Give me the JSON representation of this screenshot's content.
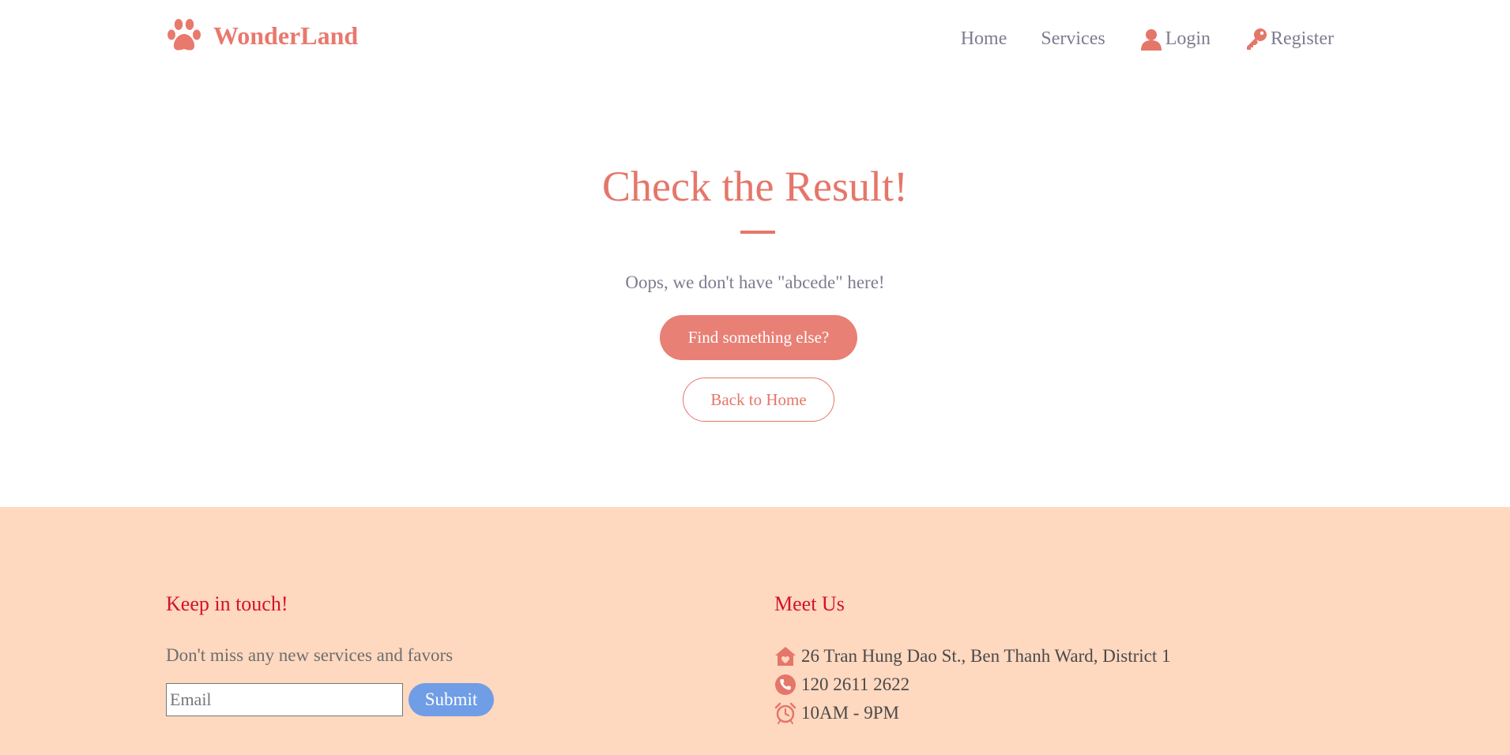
{
  "brand": {
    "name": "WonderLand",
    "icon": "paw-icon",
    "color": "#e9786d"
  },
  "nav": {
    "home": "Home",
    "services": "Services",
    "login": "Login",
    "login_icon": "user-icon",
    "register": "Register",
    "register_icon": "key-icon"
  },
  "main": {
    "title": "Check the Result!",
    "message": "Oops, we don't have \"abcede\" here!",
    "find_button": "Find something else?",
    "home_button": "Back to Home"
  },
  "footer": {
    "keep_title": "Keep in touch!",
    "subscribe_text": "Don't miss any new services and favors",
    "email_placeholder": "Email",
    "submit_label": "Submit",
    "meet_title": "Meet Us",
    "address": "26 Tran Hung Dao St., Ben Thanh Ward, District 1",
    "phone": "120 2611 2622",
    "hours": "10AM - 9PM",
    "address_icon": "home-icon",
    "phone_icon": "phone-icon",
    "hours_icon": "alarm-clock-icon"
  },
  "colors": {
    "accent": "#e5766a",
    "footer_bg": "#fed8bf",
    "footer_heading": "#d4112b",
    "submit_bg": "#6f9de6",
    "nav_text": "#7d7c90"
  }
}
